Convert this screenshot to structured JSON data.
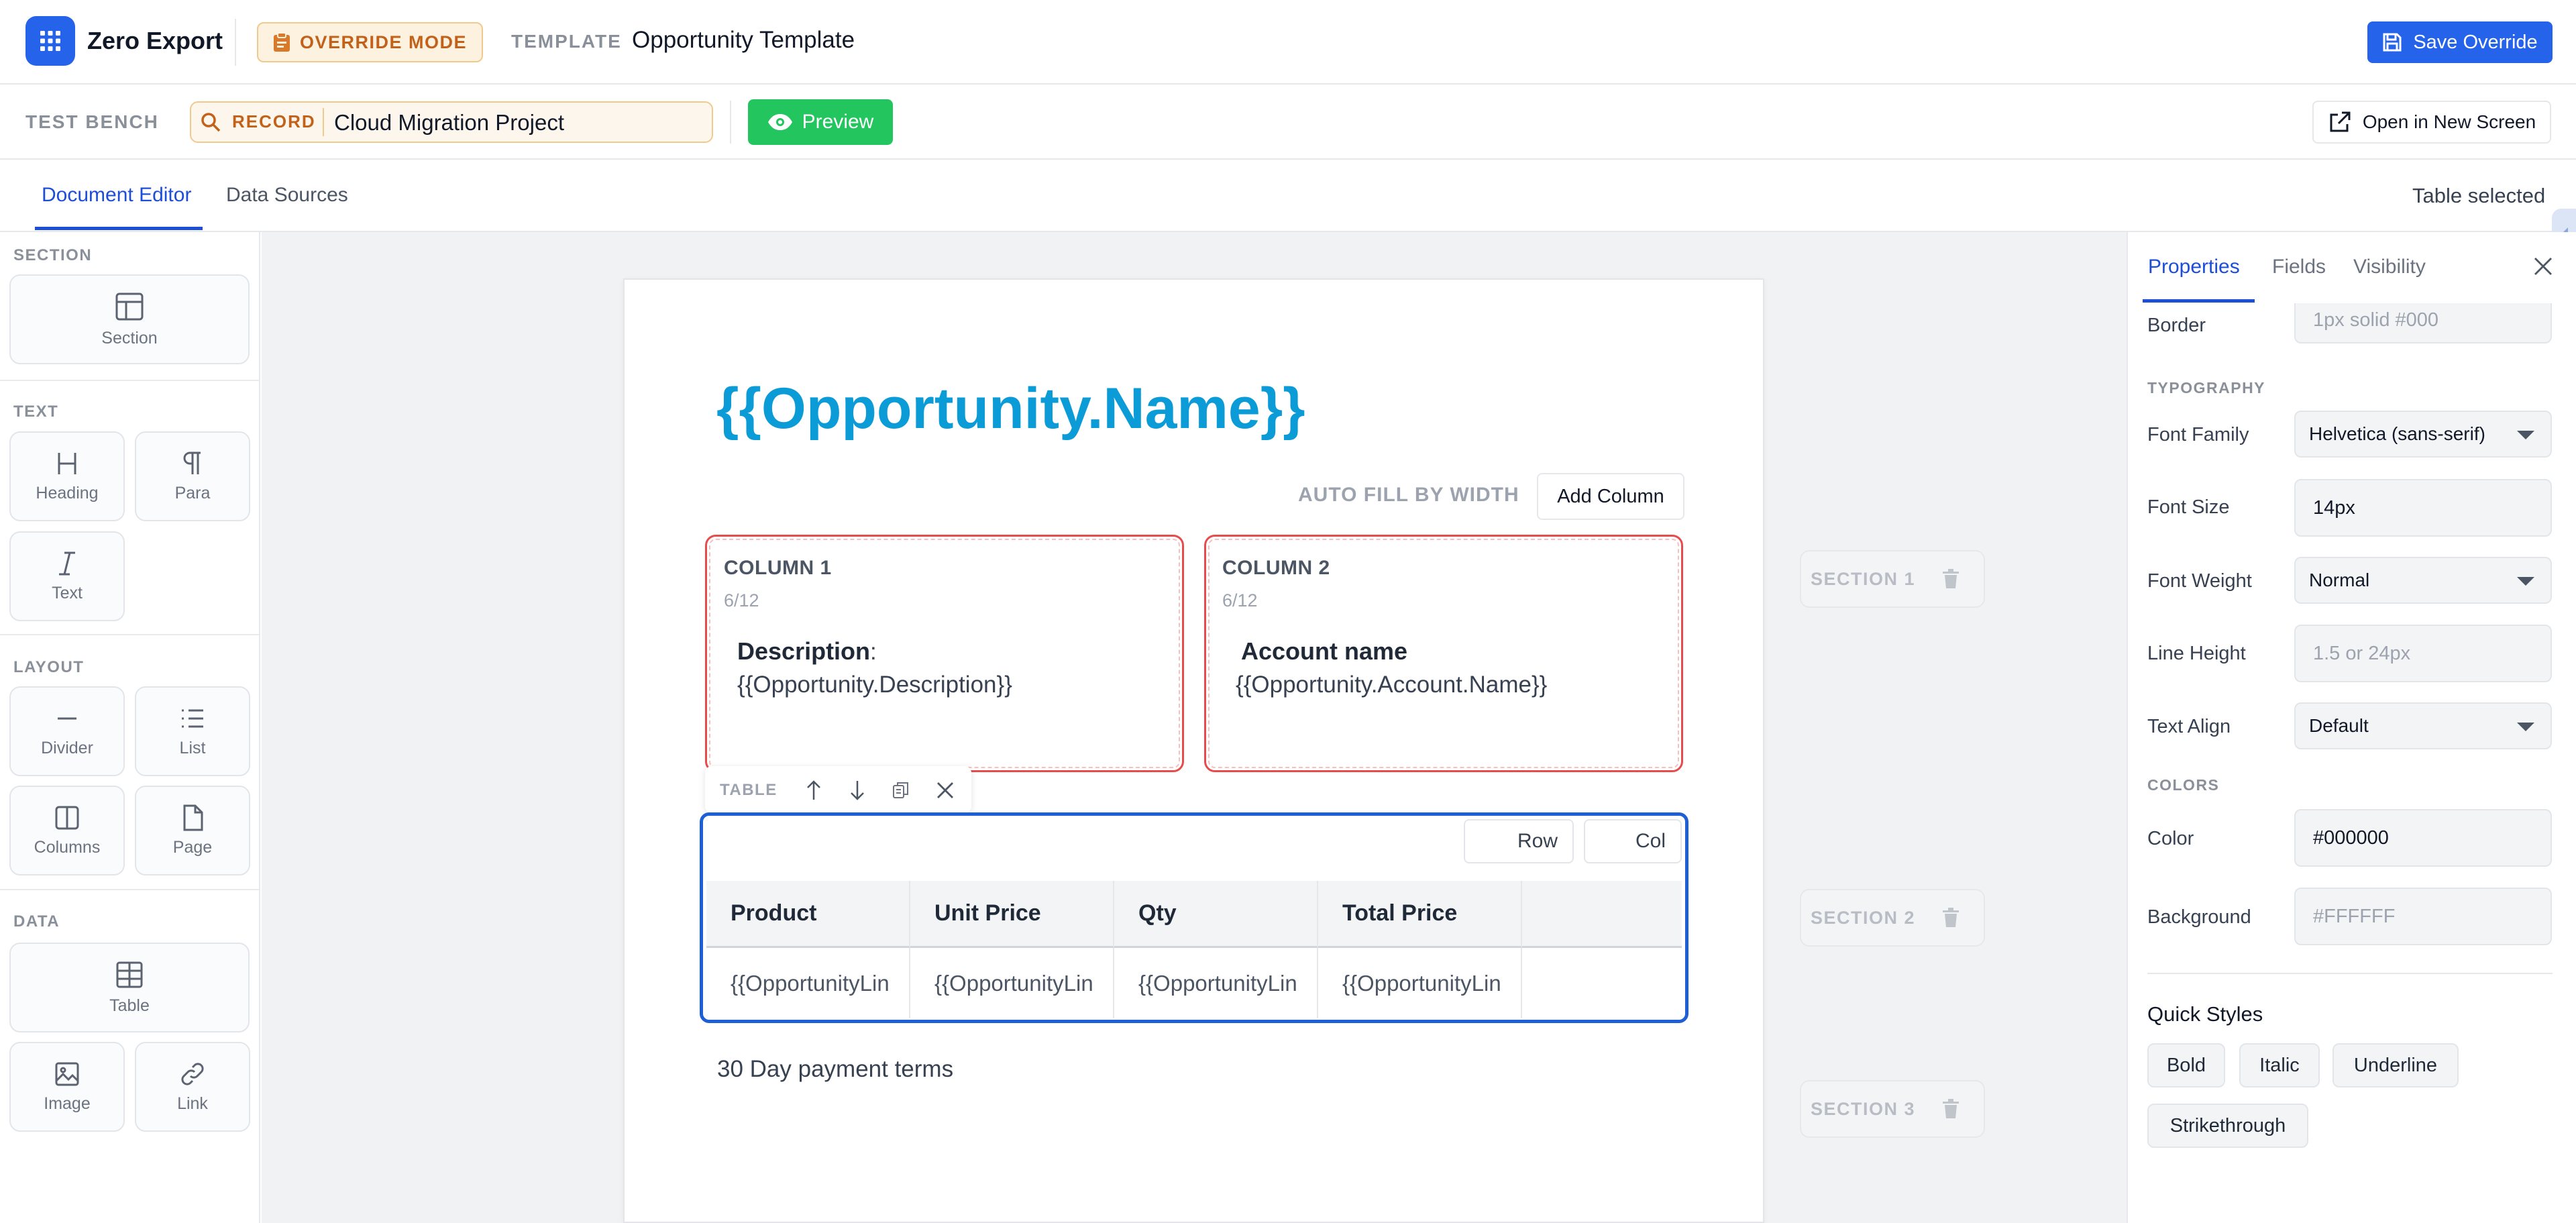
{
  "app": {
    "name": "Zero Export",
    "override_badge": "OVERRIDE MODE",
    "template_label": "TEMPLATE",
    "template_name": "Opportunity Template",
    "save_button": "Save Override"
  },
  "bench": {
    "label": "TEST BENCH",
    "record_label": "RECORD",
    "record_value": "Cloud Migration Project",
    "preview_button": "Preview",
    "open_button": "Open in New Screen"
  },
  "tabs": {
    "document_editor": "Document Editor",
    "data_sources": "Data Sources",
    "status": "Table selected"
  },
  "palette": {
    "groups": [
      "SECTION",
      "TEXT",
      "LAYOUT",
      "DATA"
    ],
    "items": {
      "section": "Section",
      "heading": "Heading",
      "para": "Para",
      "text": "Text",
      "divider": "Divider",
      "list": "List",
      "columns": "Columns",
      "page": "Page",
      "table": "Table",
      "image": "Image",
      "link": "Link"
    }
  },
  "document": {
    "title": "{{Opportunity.Name}}",
    "autofill_label": "AUTO FILL BY WIDTH",
    "add_column": "Add Column",
    "columns": [
      {
        "title": "COLUMN 1",
        "span": "6/12",
        "bold": "Description",
        "suffix": ":",
        "field": "{{Opportunity.Description}}"
      },
      {
        "title": "COLUMN 2",
        "span": "6/12",
        "bold": "Account name",
        "suffix": "",
        "field": "{{Opportunity.Account.Name}}"
      }
    ],
    "table_toolbar_label": "TABLE",
    "table": {
      "row_button": "Row",
      "col_button": "Col",
      "headers": [
        "Product",
        "Unit Price",
        "Qty",
        "Total Price",
        ""
      ],
      "cells": [
        "{{OpportunityLin",
        "{{OpportunityLin",
        "{{OpportunityLin",
        "{{OpportunityLin",
        ""
      ]
    },
    "footer_text": "30 Day payment terms"
  },
  "sections": [
    "SECTION 1",
    "SECTION 2",
    "SECTION 3"
  ],
  "properties": {
    "tabs": [
      "Properties",
      "Fields",
      "Visibility"
    ],
    "border_label": "Border",
    "border_placeholder": "1px solid #000",
    "typography_group": "TYPOGRAPHY",
    "font_family_label": "Font Family",
    "font_family_value": "Helvetica (sans-serif)",
    "font_size_label": "Font Size",
    "font_size_value": "14px",
    "font_weight_label": "Font Weight",
    "font_weight_value": "Normal",
    "line_height_label": "Line Height",
    "line_height_placeholder": "1.5 or 24px",
    "text_align_label": "Text Align",
    "text_align_value": "Default",
    "colors_group": "COLORS",
    "color_label": "Color",
    "color_value": "#000000",
    "background_label": "Background",
    "background_placeholder": "#FFFFFF",
    "quick_styles_title": "Quick Styles",
    "quick_styles": [
      "Bold",
      "Italic",
      "Underline",
      "Strikethrough"
    ]
  },
  "colors": {
    "accent": "#2563eb",
    "preview": "#22c55e",
    "override": "#c2621a",
    "title": "#0b9bd7",
    "column_border": "#e74c4c",
    "table_selected": "#1e5fd8"
  },
  "icons": [
    "apps-grid-icon",
    "clipboard-icon",
    "save-icon",
    "search-icon",
    "eye-icon",
    "external-link-icon",
    "close-icon",
    "trash-icon",
    "arrow-up-icon",
    "arrow-down-icon",
    "copy-icon"
  ]
}
